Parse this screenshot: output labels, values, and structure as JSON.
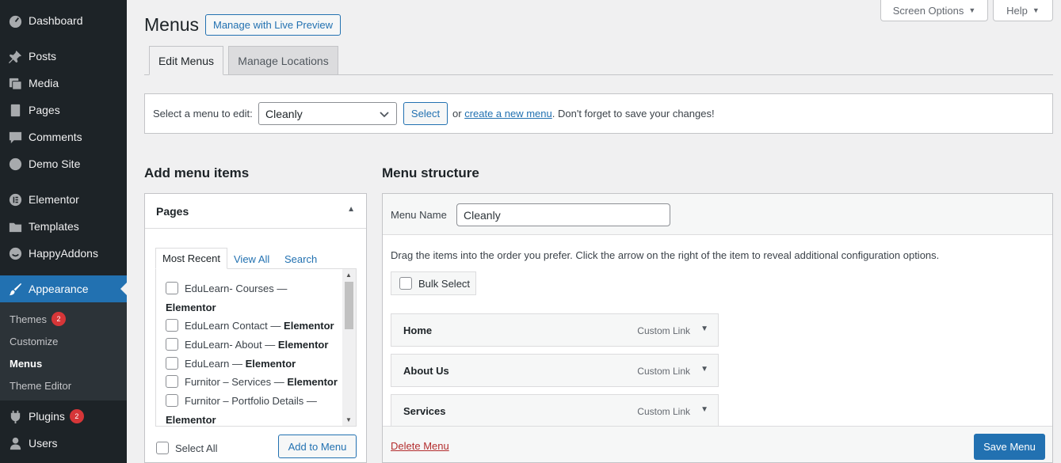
{
  "sidebar": {
    "items": [
      {
        "label": "Dashboard",
        "icon": "dashboard-icon"
      },
      {
        "label": "Posts",
        "icon": "pin-icon"
      },
      {
        "label": "Media",
        "icon": "media-icon"
      },
      {
        "label": "Pages",
        "icon": "page-icon"
      },
      {
        "label": "Comments",
        "icon": "comment-icon"
      },
      {
        "label": "Demo Site",
        "icon": "globe-icon"
      },
      {
        "label": "Elementor",
        "icon": "elementor-icon"
      },
      {
        "label": "Templates",
        "icon": "folder-icon"
      },
      {
        "label": "HappyAddons",
        "icon": "happyaddons-icon"
      },
      {
        "label": "Appearance",
        "icon": "brush-icon"
      },
      {
        "label": "Plugins",
        "icon": "plug-icon",
        "badge": "2"
      },
      {
        "label": "Users",
        "icon": "user-icon"
      }
    ],
    "submenu": [
      {
        "label": "Themes",
        "badge": "2"
      },
      {
        "label": "Customize"
      },
      {
        "label": "Menus"
      },
      {
        "label": "Theme Editor"
      }
    ],
    "active_color": "#2271b1"
  },
  "top": {
    "screen_options": "Screen Options",
    "help": "Help"
  },
  "header": {
    "title": "Menus",
    "live_preview": "Manage with Live Preview",
    "tabs": [
      "Edit Menus",
      "Manage Locations"
    ]
  },
  "select_bar": {
    "label": "Select a menu to edit:",
    "selected": "Cleanly",
    "button": "Select",
    "hint_prefix": "or",
    "hint_link": "create a new menu",
    "hint_suffix": ". Don't forget to save your changes!"
  },
  "add_items": {
    "heading": "Add menu items",
    "box_title": "Pages",
    "tabs": [
      "Most Recent",
      "View All",
      "Search"
    ],
    "pages": [
      {
        "name": "EduLearn- Courses —",
        "bold": "Elementor"
      },
      {
        "name": "EduLearn Contact —",
        "bold": "Elementor"
      },
      {
        "name": "EduLearn- About —",
        "bold": "Elementor"
      },
      {
        "name": "EduLearn —",
        "bold": "Elementor"
      },
      {
        "name": "Furnitor – Services —",
        "bold": "Elementor"
      },
      {
        "name": "Furnitor – Portfolio Details —",
        "bold": "Elementor"
      }
    ],
    "select_all": "Select All",
    "add_button": "Add to Menu"
  },
  "structure": {
    "heading": "Menu structure",
    "name_label": "Menu Name",
    "name_value": "Cleanly",
    "drag_hint": "Drag the items into the order you prefer. Click the arrow on the right of the item to reveal additional configuration options.",
    "bulk_select": "Bulk Select",
    "items": [
      {
        "title": "Home",
        "type": "Custom Link"
      },
      {
        "title": "About Us",
        "type": "Custom Link"
      },
      {
        "title": "Services",
        "type": "Custom Link"
      }
    ],
    "delete": "Delete Menu",
    "save": "Save Menu"
  }
}
